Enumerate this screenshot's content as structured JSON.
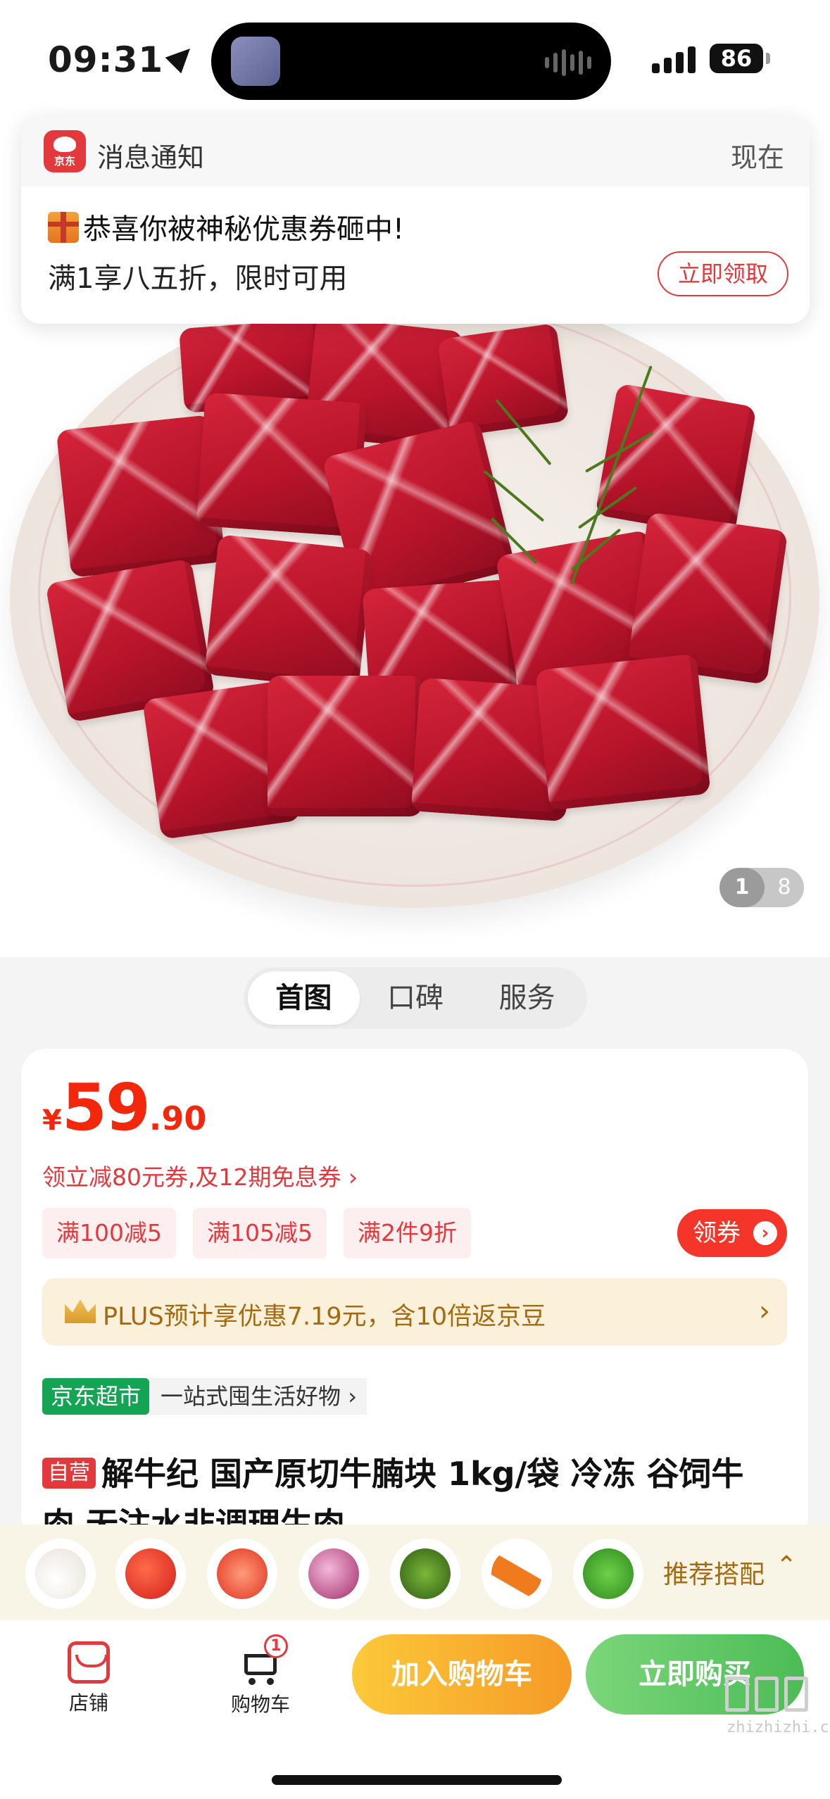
{
  "status_bar": {
    "time": "09:31",
    "battery": "86"
  },
  "notification": {
    "app_name": "消息通知",
    "time": "现在",
    "app_icon_label": "京东",
    "title": "恭喜你被神秘优惠券砸中!",
    "body": "满1享八五折，限时可用",
    "action": "立即领取"
  },
  "gallery": {
    "current": "1",
    "total": "8"
  },
  "tabs": [
    {
      "label": "首图"
    },
    {
      "label": "口碑"
    },
    {
      "label": "服务"
    }
  ],
  "product": {
    "currency": "¥",
    "price_int": "59",
    "price_dec": ".90",
    "coupon_line": "领立减80元券,及12期免息券 ›",
    "promo_tags": [
      "满100减5",
      "满105减5",
      "满2件9折"
    ],
    "coupon_button": "领券",
    "plus_text": "PLUS预计享优惠7.19元，含10倍返京豆",
    "store_badge": "京东超市",
    "store_slogan": "一站式囤生活好物 ›",
    "self_tag": "自营",
    "title": "解牛纪 国产原切牛腩块 1kg/袋 冷冻 谷饲牛",
    "title_cont": "肉 无注水非调理生肉 ⌄"
  },
  "recommend": {
    "label": "推荐搭配",
    "chevron": "⌃"
  },
  "bottom_bar": {
    "shop_label": "店铺",
    "cart_label": "购物车",
    "cart_count": "1",
    "add_to_cart": "加入购物车",
    "buy_now": "立即购买"
  },
  "watermark": {
    "text": "zhizhizhi.com"
  },
  "colors": {
    "jd_red": "#e4393c",
    "price_red": "#f2270c",
    "plus_gold": "#a56a10",
    "store_green": "#15a453"
  }
}
